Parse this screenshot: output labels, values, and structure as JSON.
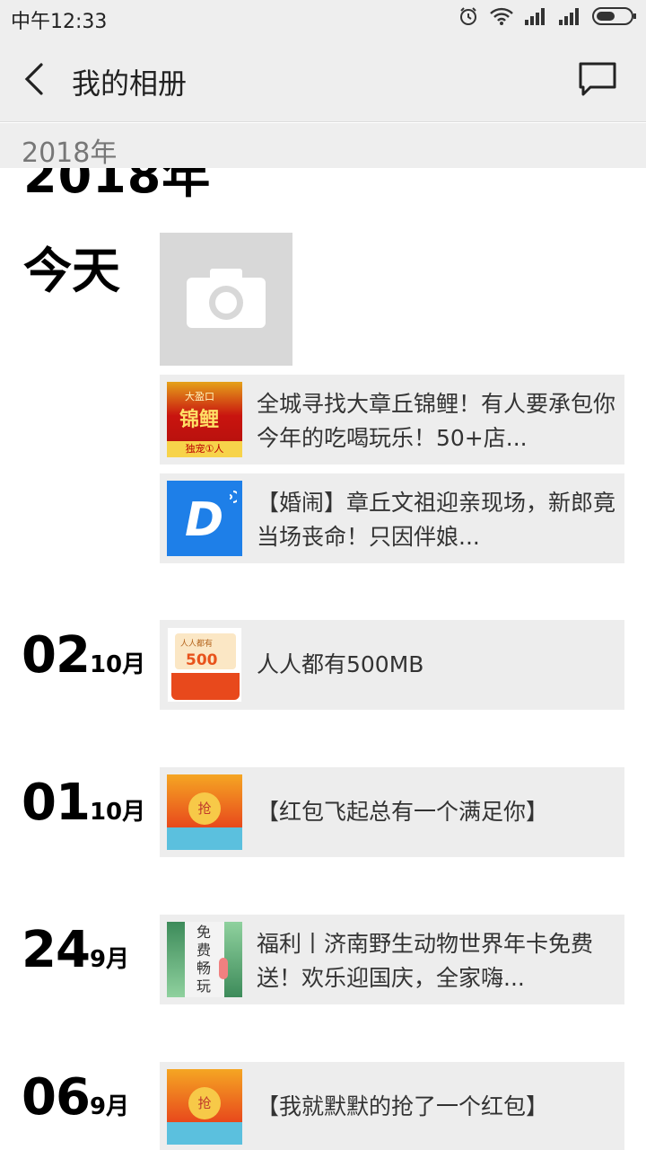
{
  "status": {
    "time": "中午12:33"
  },
  "header": {
    "title": "我的相册"
  },
  "year_strip": "2018年",
  "year_big": "2018年",
  "today_label": "今天",
  "today_posts": [
    {
      "text": "全城寻找大章丘锦鲤！有人要承包你今年的吃喝玩乐！50+店...",
      "thumb_text": [
        "大盈口",
        "锦鲤",
        "独宠①人"
      ]
    },
    {
      "text": "【婚闹】章丘文祖迎亲现场，新郎竟当场丧命！只因伴娘...",
      "thumb_text": "D"
    }
  ],
  "entries": [
    {
      "day": "02",
      "month": "10月",
      "text": "人人都有500MB",
      "thumb_text": [
        "人人都有",
        "500"
      ]
    },
    {
      "day": "01",
      "month": "10月",
      "text": "【红包飞起总有一个满足你】",
      "thumb_text": "抢"
    },
    {
      "day": "24",
      "month": "9月",
      "text": "福利丨济南野生动物世界年卡免费送！欢乐迎国庆，全家嗨...",
      "thumb_text": [
        "免",
        "费",
        "畅",
        "玩"
      ]
    },
    {
      "day": "06",
      "month": "9月",
      "text": "【我就默默的抢了一个红包】",
      "thumb_text": "抢"
    }
  ]
}
